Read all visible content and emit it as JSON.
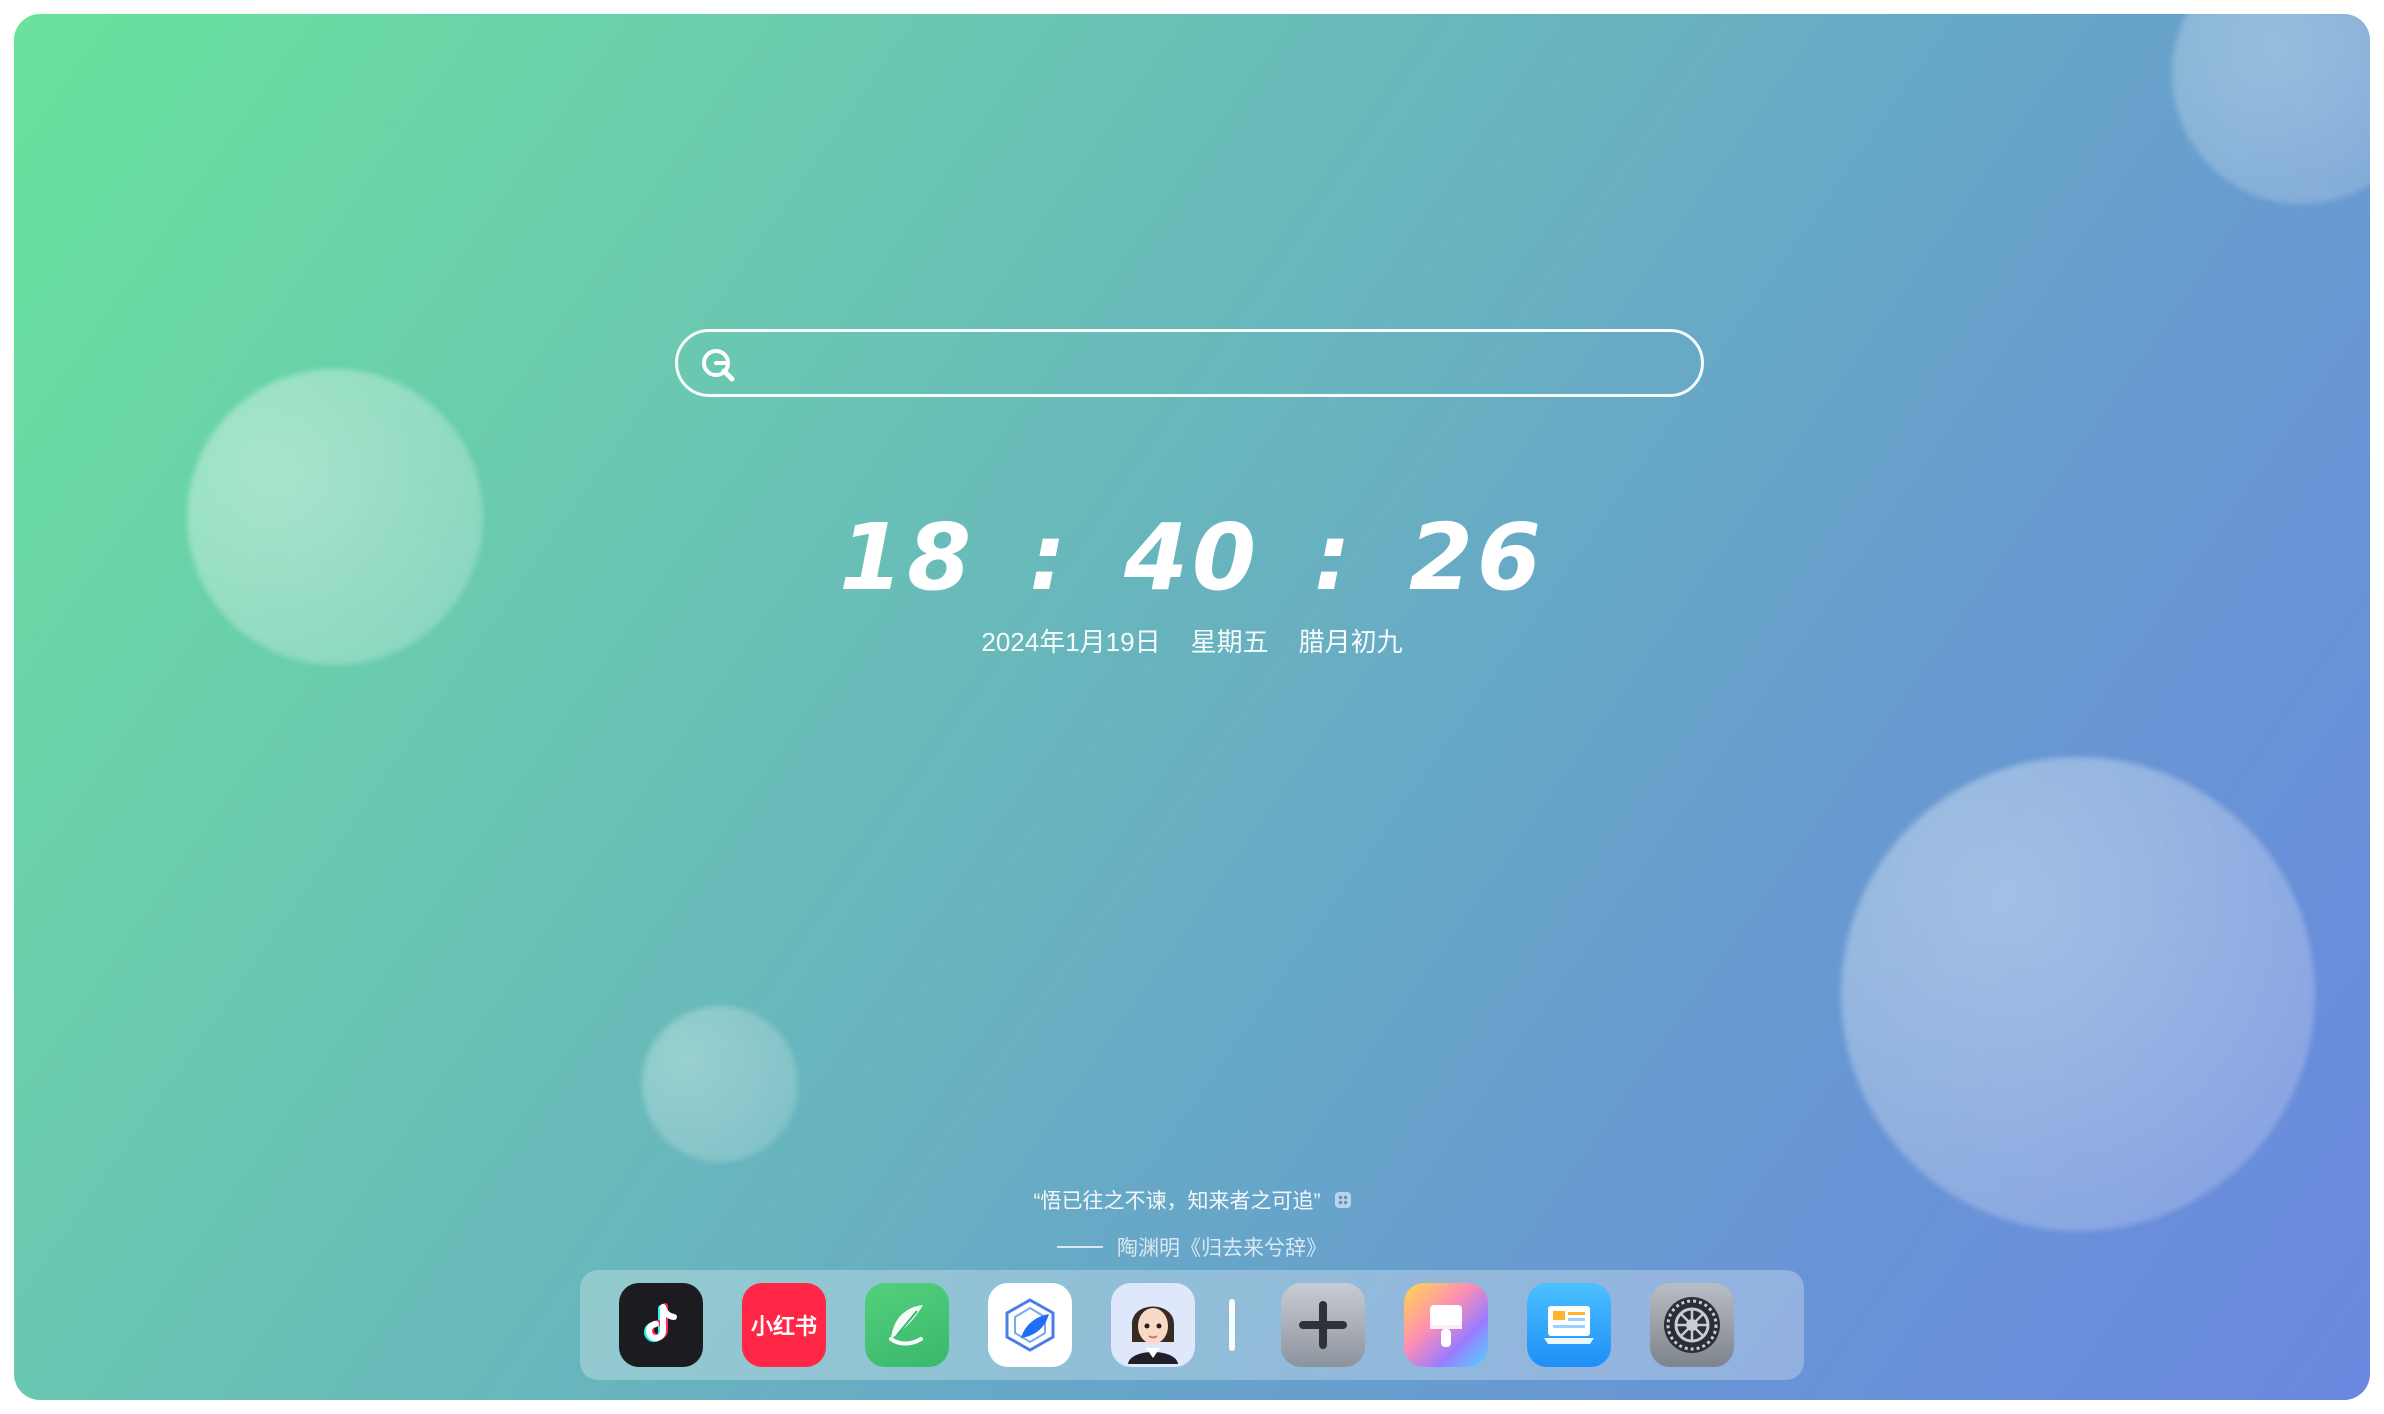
{
  "search": {
    "value": "",
    "placeholder": ""
  },
  "clock": {
    "hours": "18",
    "minutes": "40",
    "seconds": "26",
    "separator": ":"
  },
  "date": {
    "gregorian": "2024年1月19日",
    "weekday": "星期五",
    "lunar": "腊月初九"
  },
  "quote": {
    "text": "“悟已往之不谏，知来者之可追”",
    "author": "陶渊明《归去来兮辞》"
  },
  "dock": {
    "apps": [
      {
        "name": "tiktok",
        "icon": "tiktok-icon"
      },
      {
        "name": "xiaohongshu",
        "label": "小红书",
        "icon": "xiaohongshu-icon"
      },
      {
        "name": "feather",
        "icon": "feather-icon"
      },
      {
        "name": "ai-assistant",
        "icon": "leaf-cube-icon"
      },
      {
        "name": "avatar",
        "icon": "avatar-icon"
      },
      {
        "name": "add",
        "icon": "plus-icon"
      },
      {
        "name": "theme",
        "icon": "paintbrush-icon"
      },
      {
        "name": "news",
        "icon": "news-card-icon"
      },
      {
        "name": "settings",
        "icon": "gear-icon"
      }
    ]
  },
  "colors": {
    "gradient_start": "#69e29c",
    "gradient_end": "#6b87e0",
    "text": "#ffffff"
  }
}
